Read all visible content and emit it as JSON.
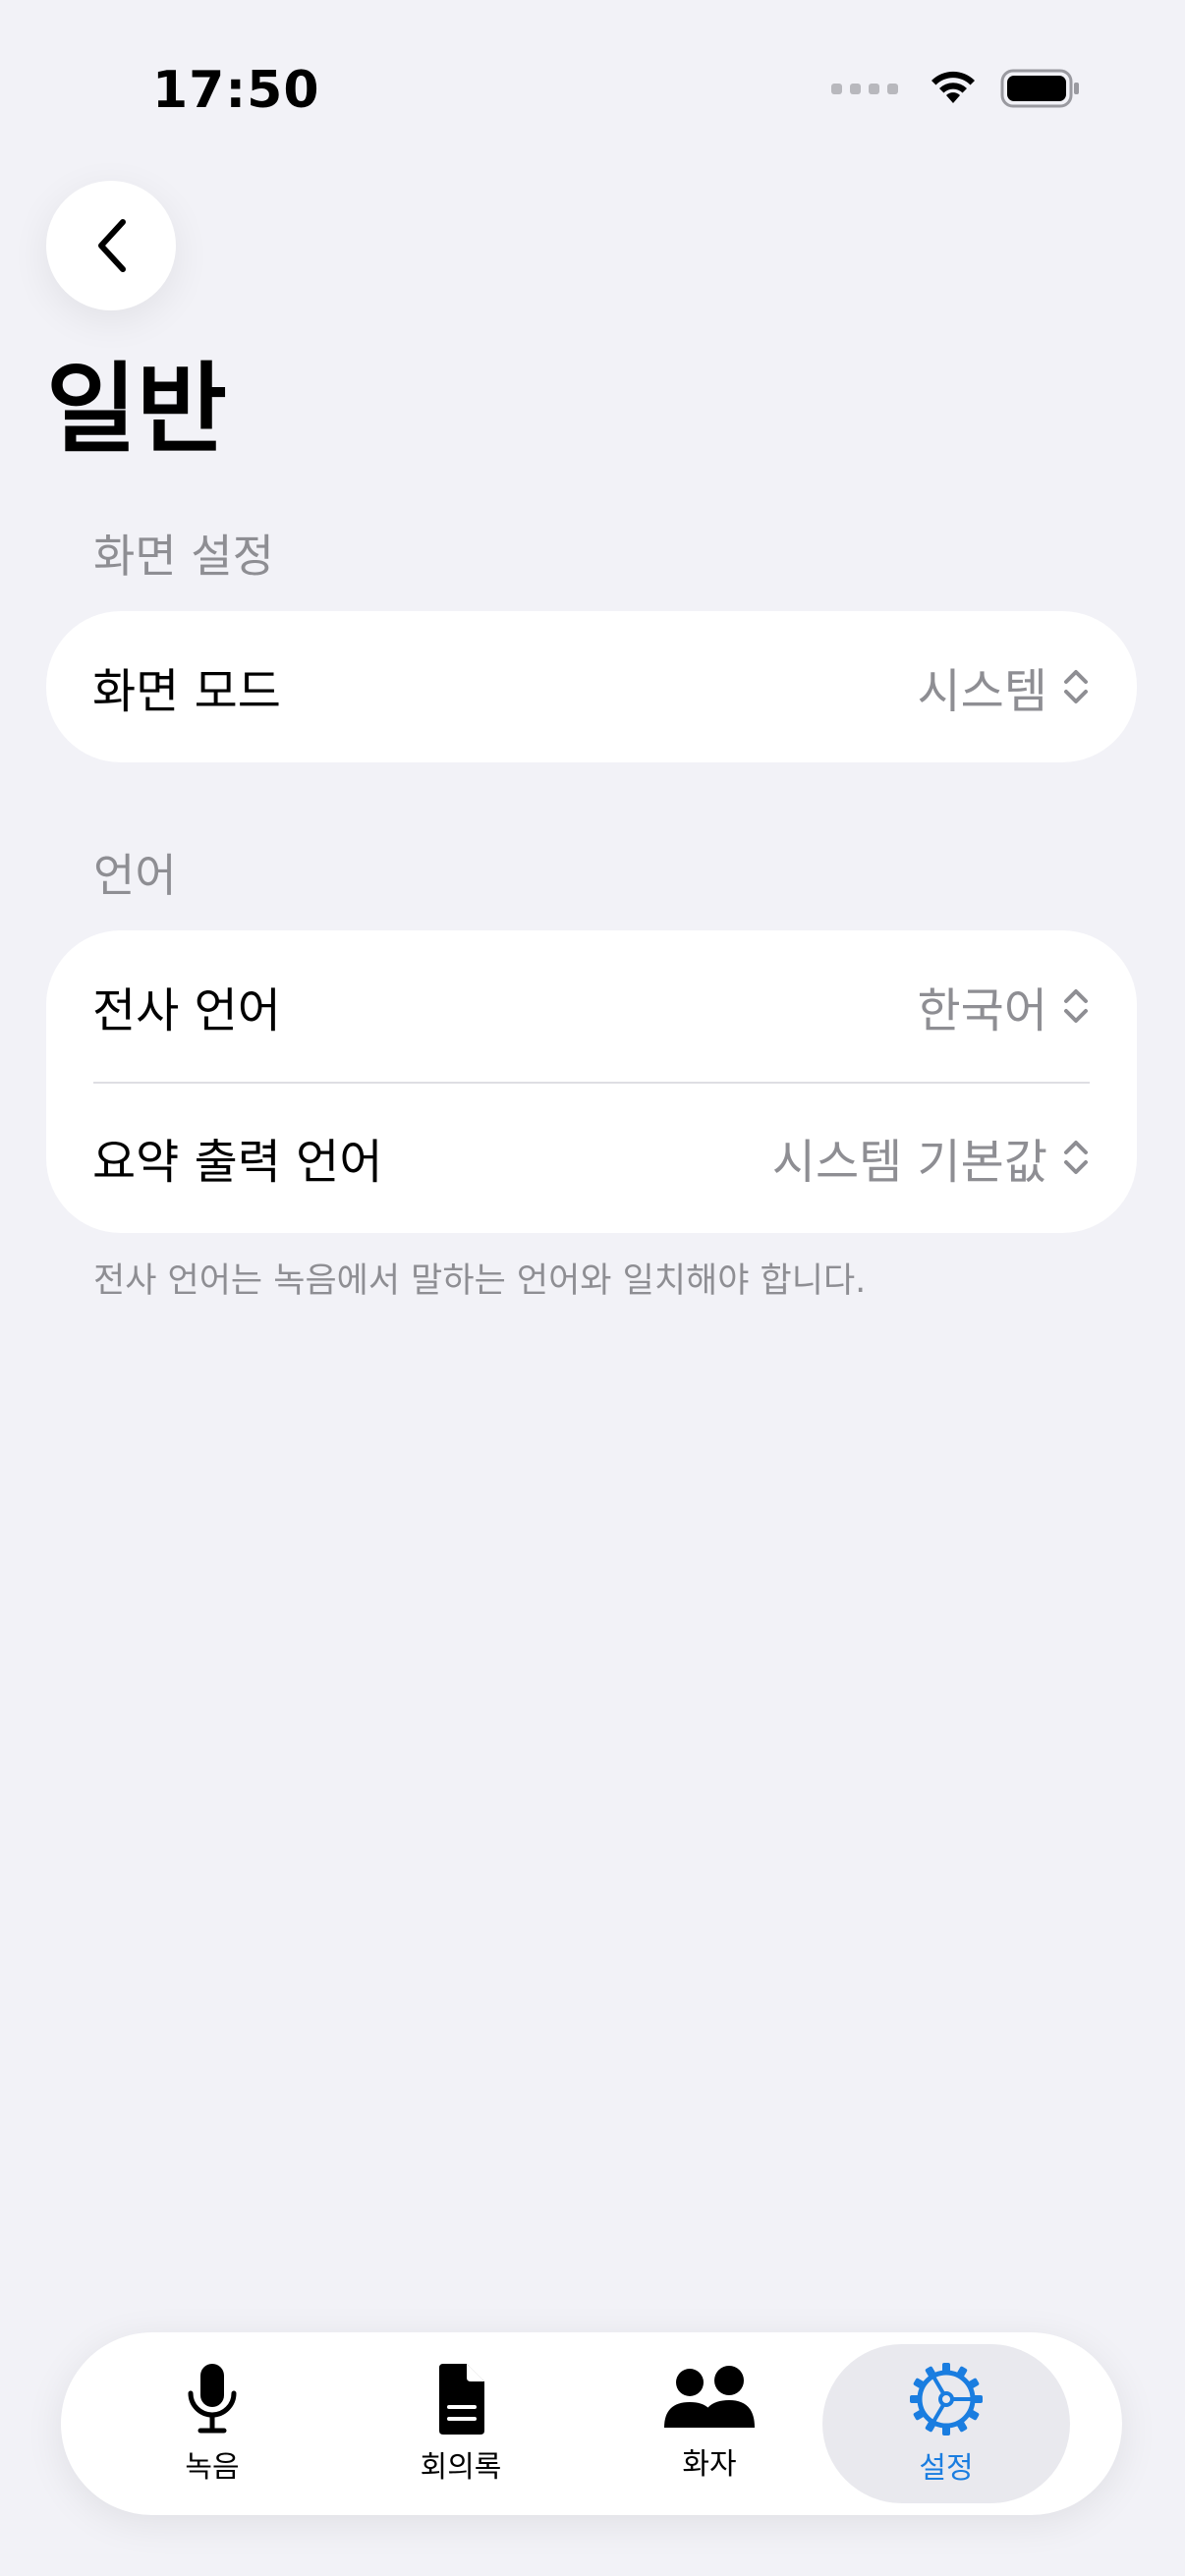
{
  "status_bar": {
    "time": "17:50"
  },
  "page": {
    "title": "일반"
  },
  "sections": [
    {
      "header": "화면 설정",
      "rows": [
        {
          "label": "화면 모드",
          "value": "시스템"
        }
      ]
    },
    {
      "header": "언어",
      "rows": [
        {
          "label": "전사 언어",
          "value": "한국어"
        },
        {
          "label": "요약 출력 언어",
          "value": "시스템 기본값"
        }
      ],
      "footer": "전사 언어는 녹음에서 말하는 언어와 일치해야 합니다."
    }
  ],
  "tab_bar": {
    "tabs": [
      {
        "label": "녹음",
        "icon": "mic-icon"
      },
      {
        "label": "회의록",
        "icon": "document-icon"
      },
      {
        "label": "화자",
        "icon": "people-icon"
      },
      {
        "label": "설정",
        "icon": "gear-icon"
      }
    ],
    "active_index": 3
  },
  "colors": {
    "background": "#f2f2f7",
    "accent": "#1a7de0",
    "secondary_text": "#8e8e93"
  }
}
